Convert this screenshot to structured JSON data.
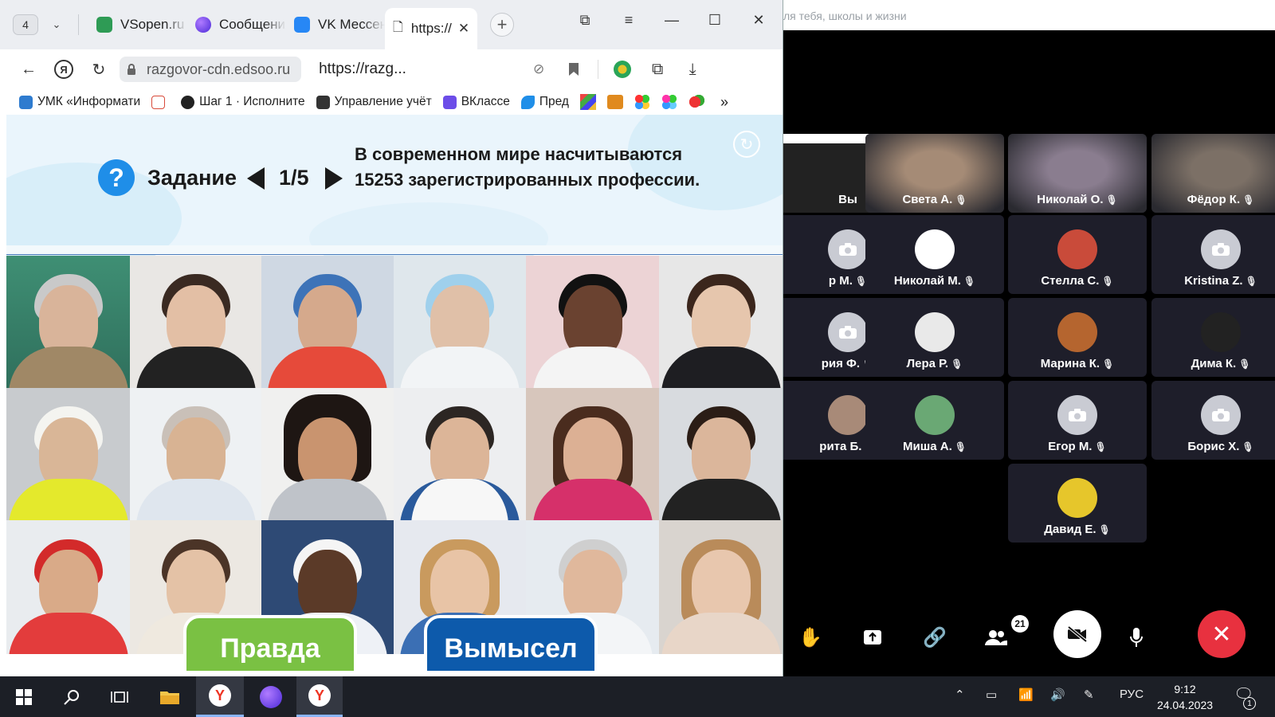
{
  "browser": {
    "tab_count": "4",
    "tabs": [
      {
        "label": "VSopen.ru",
        "icon": "vsopen-icon",
        "color": "#2e9b55"
      },
      {
        "label": "Сообщения",
        "icon": "messenger-icon",
        "color": "#7a4dff"
      },
      {
        "label": "VK Мессенджер",
        "icon": "vk-icon",
        "color": "#2787f5"
      },
      {
        "label": "https://",
        "icon": "page-icon",
        "color": "#ffffff",
        "active": true
      }
    ],
    "domain": "razgovor-cdn.edsoo.ru",
    "url": "https://razg...",
    "bookmarks": [
      {
        "label": "УМК «Информати",
        "color": "#2e7bcf"
      },
      {
        "label": "",
        "color": "#d84a3a"
      },
      {
        "label": "Шаг 1 · Исполните",
        "color": "#222222"
      },
      {
        "label": "Управление учёт",
        "color": "#333333"
      },
      {
        "label": "ВКлассе",
        "color": "#6c4de8"
      },
      {
        "label": "Пред",
        "color": "#1f8ee8"
      }
    ],
    "more_bookmarks": "»"
  },
  "task": {
    "label": "Задание",
    "counter": "1/5",
    "statement": "В современном мире насчитываются 15253 зарегистрированных профессии.",
    "answers": {
      "true_label": "Правда",
      "fiction_label": "Вымысел"
    }
  },
  "call": {
    "page_title": "ля тебя, школы и жизни",
    "participants": [
      {
        "name": "Вы",
        "type": "screen",
        "mic": ""
      },
      {
        "name": "Света А.",
        "type": "video",
        "mic": "🎤̸",
        "bg": "#a58b76"
      },
      {
        "name": "Николай О.",
        "type": "video",
        "mic": "🎤̸",
        "bg": "#8a7d8f"
      },
      {
        "name": "Фёдор К.",
        "type": "video",
        "mic": "🎤̸",
        "bg": "#7c7066"
      },
      {
        "name": "р М.",
        "type": "camera",
        "mic": "🎤̸"
      },
      {
        "name": "Николай М.",
        "type": "avatar",
        "mic": "🎤̸",
        "avatar_color": "#ffffff"
      },
      {
        "name": "Стелла С.",
        "type": "avatar",
        "mic": "🎤̸",
        "avatar_color": "#c94b3a"
      },
      {
        "name": "Kristina Z.",
        "type": "camera",
        "mic": "🎤̸"
      },
      {
        "name": "рия Ф.",
        "type": "camera",
        "mic": "🎤̸"
      },
      {
        "name": "Лера Р.",
        "type": "avatar",
        "mic": "🎤̸",
        "avatar_color": "#e9e9e9"
      },
      {
        "name": "Марина К.",
        "type": "avatar",
        "mic": "🎤̸",
        "avatar_color": "#b5652f"
      },
      {
        "name": "Дима К.",
        "type": "avatar",
        "mic": "🎤̸",
        "avatar_color": "#222222"
      },
      {
        "name": "рита Б.",
        "type": "avatar",
        "mic": "🎤̸",
        "avatar_color": "#a88a78"
      },
      {
        "name": "Миша А.",
        "type": "avatar",
        "mic": "🎤̸",
        "avatar_color": "#6aa874"
      },
      {
        "name": "Егор М.",
        "type": "camera",
        "mic": "🎤̸"
      },
      {
        "name": "Борис Х.",
        "type": "camera",
        "mic": "🎤̸"
      },
      {
        "name": "Давид Е.",
        "type": "avatar",
        "mic": "🎤̸",
        "avatar_color": "#e6c62b"
      }
    ],
    "participants_badge": "21"
  },
  "taskbar": {
    "language": "РУС",
    "time": "9:12",
    "date": "24.04.2023",
    "notifications": "1"
  },
  "colors": {
    "accent_blue": "#1f8ee8",
    "true_green": "#7ac143",
    "fiction_blue": "#0d5aab",
    "hangup_red": "#e8313f"
  }
}
